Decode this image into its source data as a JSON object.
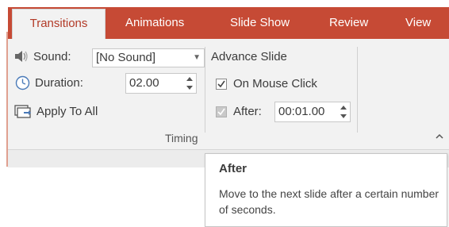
{
  "tabs": [
    {
      "label": "Transitions",
      "active": true
    },
    {
      "label": "Animations",
      "active": false
    },
    {
      "label": "Slide Show",
      "active": false
    },
    {
      "label": "Review",
      "active": false
    },
    {
      "label": "View",
      "active": false
    }
  ],
  "timing": {
    "sound_label": "Sound:",
    "sound_value": "[No Sound]",
    "duration_label": "Duration:",
    "duration_value": "02.00",
    "apply_all_label": "Apply To All",
    "advance_slide_label": "Advance Slide",
    "on_mouse_click_label": "On Mouse Click",
    "on_mouse_click_checked": true,
    "after_label": "After:",
    "after_checked": true,
    "after_value": "00:01.00",
    "group_label": "Timing"
  },
  "tooltip": {
    "title": "After",
    "body": "Move to the next slide after a certain number of seconds."
  },
  "colors": {
    "tab_bar": "#c64a35",
    "active_tab_text": "#b23a27",
    "ribbon_bg": "#f2f2f2"
  },
  "icons": [
    "speaker-icon",
    "clock-icon",
    "apply-all-icon",
    "checkmark-icon",
    "chevron-up-icon",
    "spin-arrows-icon"
  ]
}
